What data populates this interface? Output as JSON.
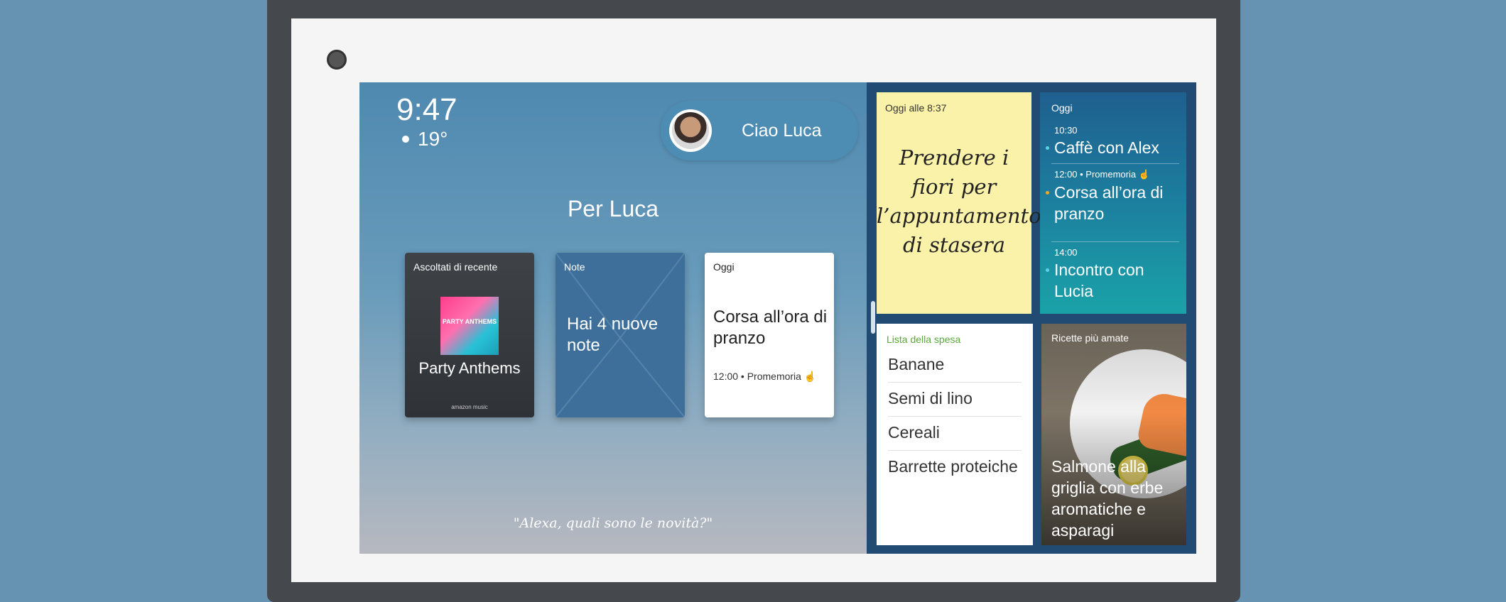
{
  "clock": {
    "time": "9:47",
    "temp": "19°"
  },
  "greeting": {
    "text": "Ciao Luca",
    "avatar_icon": "user-avatar"
  },
  "for_you": {
    "title": "Per Luca"
  },
  "cards": {
    "music": {
      "header": "Ascoltati di recente",
      "album_text": "PARTY ANTHEMS",
      "title": "Party Anthems",
      "brand": "amazon music"
    },
    "notes": {
      "header": "Note",
      "text": "Hai 4 nuove note"
    },
    "today": {
      "header": "Oggi",
      "text": "Corsa all’ora di pranzo",
      "sub": "12:00 • Promemoria",
      "sub_icon": "hand-pointer-icon"
    }
  },
  "hint": "\"Alexa, quali sono le novità?\"",
  "sticky_note": {
    "header": "Oggi alle 8:37",
    "text": "Prendere i fiori per l’appuntamento di stasera"
  },
  "agenda": {
    "header": "Oggi",
    "events": [
      {
        "time": "10:30",
        "name": "Caffè con Alex"
      },
      {
        "time": "12:00 • Promemoria",
        "name": "Corsa all’ora di pranzo"
      },
      {
        "time": "14:00",
        "name": "Incontro con Lucia"
      }
    ]
  },
  "shopping": {
    "header": "Lista della spesa",
    "items": [
      "Banane",
      "Semi di lino",
      "Cereali",
      "Barrette proteiche"
    ]
  },
  "recipe": {
    "header": "Ricette più amate",
    "title": "Salmone alla griglia con erbe aromatiche e asparagi"
  },
  "colors": {
    "sticky": "#fbf2a9",
    "right_pane": "#214b73",
    "shop_header": "#5aa83a"
  }
}
